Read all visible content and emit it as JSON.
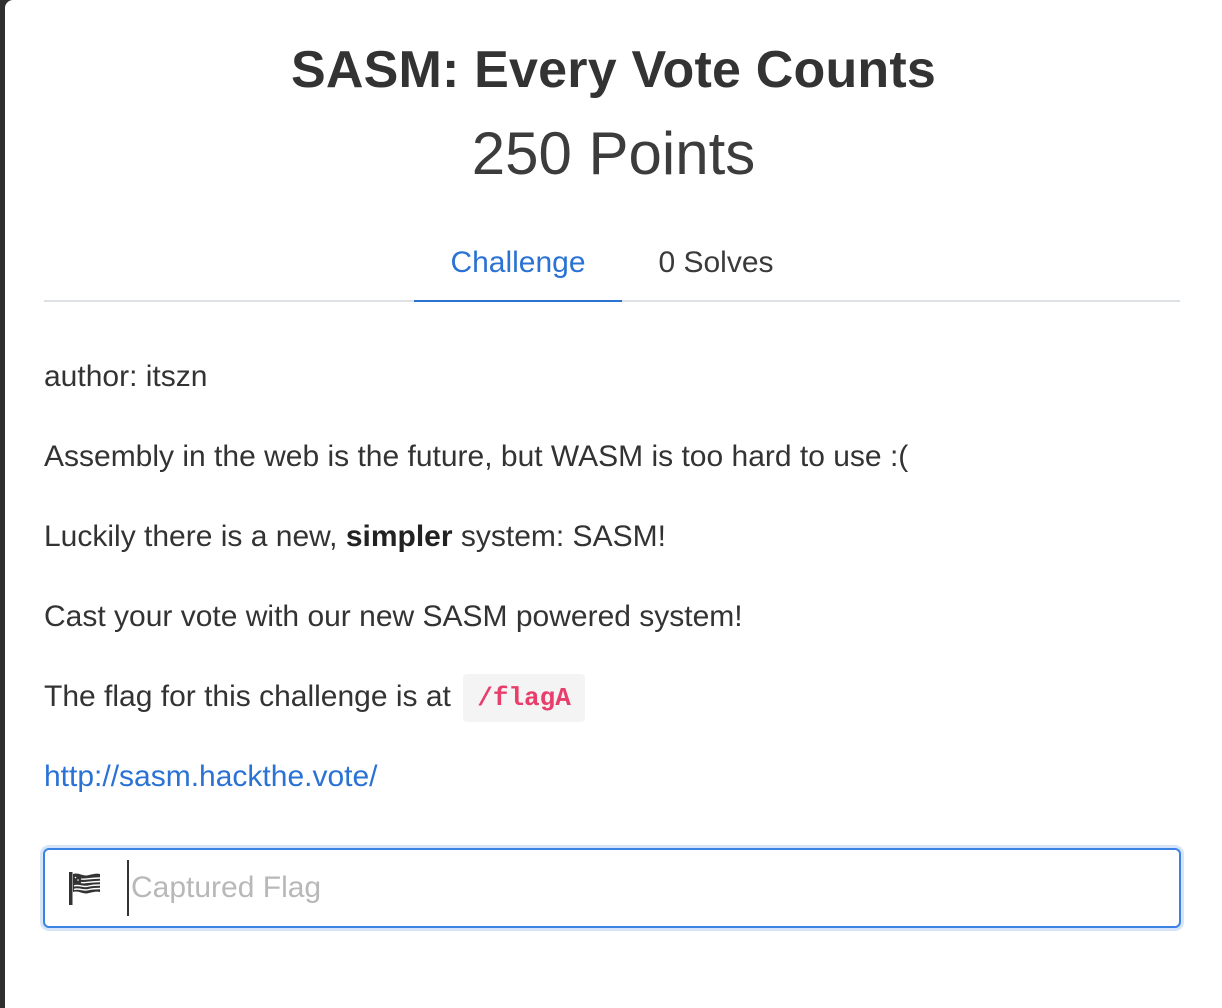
{
  "challenge": {
    "title": "SASM: Every Vote Counts",
    "points": "250 Points"
  },
  "tabs": [
    {
      "label": "Challenge",
      "active": true
    },
    {
      "label": "0 Solves",
      "active": false
    }
  ],
  "description": {
    "author": "author: itszn",
    "line1": "Assembly in the web is the future, but WASM is too hard to use :(",
    "line2_before": "Luckily there is a new, ",
    "line2_bold": "simpler",
    "line2_after": " system: SASM!",
    "line3": "Cast your vote with our new SASM powered system!",
    "line4_text": "The flag for this challenge is at ",
    "line4_code": "/flagA",
    "link": "http://sasm.hackthe.vote/"
  },
  "flag_input": {
    "placeholder": "Captured Flag",
    "value": "",
    "icon": "flag-icon"
  },
  "colors": {
    "accent": "#2a72d4",
    "code": "#e83e6c",
    "input_border": "#3c82e0"
  }
}
